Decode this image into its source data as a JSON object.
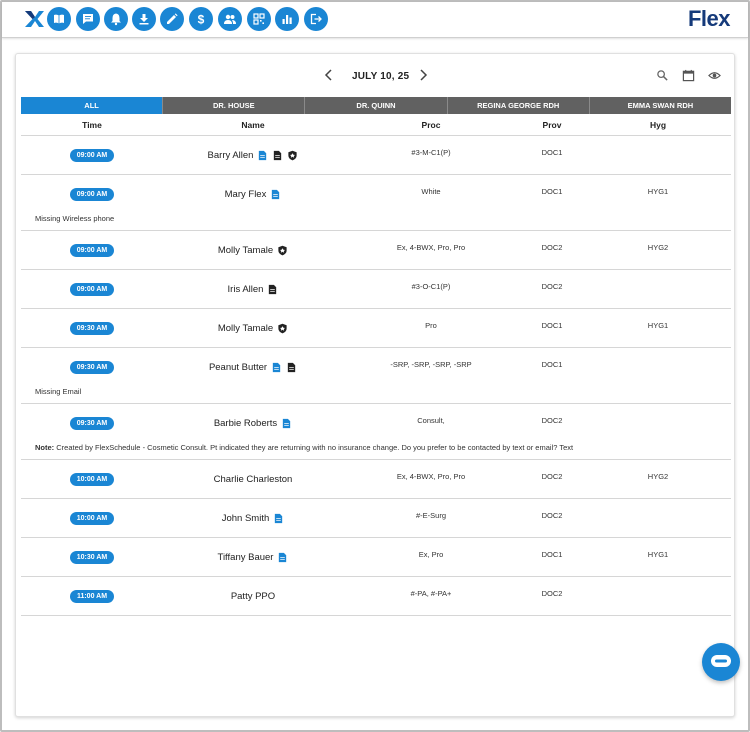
{
  "brand": {
    "name": "Flex",
    "color": "#153a7a"
  },
  "accent": "#1a86d4",
  "toolbar": {
    "icons": [
      "book-icon",
      "chat-icon",
      "bell-icon",
      "download-icon",
      "pencil-icon",
      "dollar-icon",
      "people-icon",
      "qr-code-icon",
      "bar-chart-icon",
      "logout-icon"
    ]
  },
  "schedule": {
    "date": "JULY 10, 25",
    "tabs": [
      "ALL",
      "DR. HOUSE",
      "DR. QUINN",
      "REGINA GEORGE RDH",
      "EMMA SWAN RDH"
    ],
    "active_tab": "ALL",
    "columns": {
      "time": "Time",
      "name": "Name",
      "proc": "Proc",
      "prov": "Prov",
      "hyg": "Hyg"
    },
    "rows": [
      {
        "time": "09:00 AM",
        "name": "Barry Allen",
        "proc": "#3-M-C1(P)",
        "prov": "DOC1",
        "hyg": "",
        "icons": [
          "form-icon",
          "document-icon",
          "shield-icon"
        ],
        "note": "",
        "note_label": ""
      },
      {
        "time": "09:00 AM",
        "name": "Mary Flex",
        "proc": "White",
        "prov": "DOC1",
        "hyg": "HYG1",
        "icons": [
          "form-icon"
        ],
        "note": "Missing Wireless phone",
        "note_label": ""
      },
      {
        "time": "09:00 AM",
        "name": "Molly Tamale",
        "proc": "Ex, 4-BWX, Pro, Pro",
        "prov": "DOC2",
        "hyg": "HYG2",
        "icons": [
          "shield-icon"
        ],
        "note": "",
        "note_label": ""
      },
      {
        "time": "09:00 AM",
        "name": "Iris Allen",
        "proc": "#3-O-C1(P)",
        "prov": "DOC2",
        "hyg": "",
        "icons": [
          "document-icon"
        ],
        "note": "",
        "note_label": ""
      },
      {
        "time": "09:30 AM",
        "name": "Molly Tamale",
        "proc": "Pro",
        "prov": "DOC1",
        "hyg": "HYG1",
        "icons": [
          "shield-icon"
        ],
        "note": "",
        "note_label": ""
      },
      {
        "time": "09:30 AM",
        "name": "Peanut Butter",
        "proc": "-SRP, -SRP, -SRP, -SRP",
        "prov": "DOC1",
        "hyg": "",
        "icons": [
          "form-icon",
          "document-icon"
        ],
        "note": "Missing Email",
        "note_label": ""
      },
      {
        "time": "09:30 AM",
        "name": "Barbie Roberts",
        "proc": "Consult,",
        "prov": "DOC2",
        "hyg": "",
        "icons": [
          "form-icon"
        ],
        "note": "Created by FlexSchedule - Cosmetic Consult. Pt indicated they are returning with no insurance change. Do you prefer to be contacted by text or email? Text",
        "note_label": "Note:"
      },
      {
        "time": "10:00 AM",
        "name": "Charlie Charleston",
        "proc": "Ex, 4-BWX, Pro, Pro",
        "prov": "DOC2",
        "hyg": "HYG2",
        "icons": [],
        "note": "",
        "note_label": ""
      },
      {
        "time": "10:00 AM",
        "name": "John Smith",
        "proc": "#-E-Surg",
        "prov": "DOC2",
        "hyg": "",
        "icons": [
          "form-icon"
        ],
        "note": "",
        "note_label": ""
      },
      {
        "time": "10:30 AM",
        "name": "Tiffany Bauer",
        "proc": "Ex, Pro",
        "prov": "DOC1",
        "hyg": "HYG1",
        "icons": [
          "form-icon"
        ],
        "note": "",
        "note_label": ""
      },
      {
        "time": "11:00 AM",
        "name": "Patty PPO",
        "proc": "#-PA, #-PA+",
        "prov": "DOC2",
        "hyg": "",
        "icons": [],
        "note": "",
        "note_label": ""
      }
    ]
  }
}
